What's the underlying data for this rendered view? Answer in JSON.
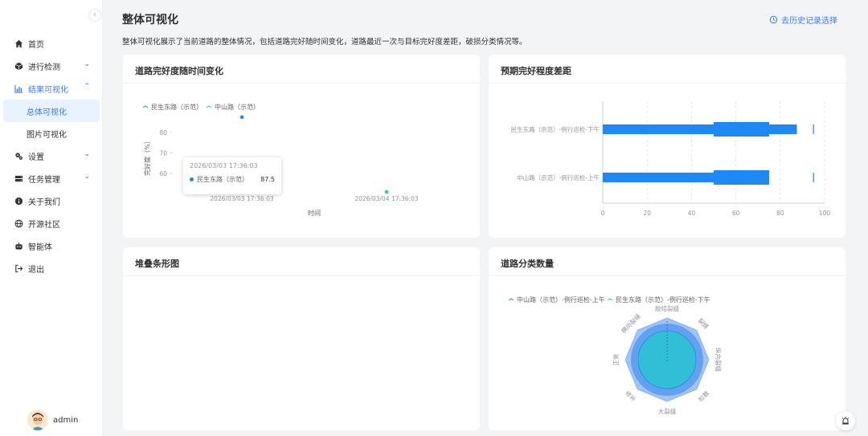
{
  "sidebar": {
    "collapse_glyph": "‹",
    "items": [
      {
        "label": "首页",
        "icon": "home-icon"
      },
      {
        "label": "进行检测",
        "icon": "cube-icon"
      },
      {
        "label": "结果可视化",
        "icon": "chart-icon"
      },
      {
        "label": "设置",
        "icon": "gear-icon"
      },
      {
        "label": "任务管理",
        "icon": "server-icon"
      },
      {
        "label": "关于我们",
        "icon": "info-icon"
      },
      {
        "label": "开源社区",
        "icon": "globe-icon"
      },
      {
        "label": "智能体",
        "icon": "robot-icon"
      },
      {
        "label": "退出",
        "icon": "logout-icon"
      }
    ],
    "submenu": [
      {
        "label": "总体可视化"
      },
      {
        "label": "图片可视化"
      }
    ],
    "user": {
      "name": "admin"
    }
  },
  "header": {
    "title": "整体可视化",
    "history_link": "去历史记录选择",
    "description": "整体可视化展示了当前道路的整体情况，包括道路完好随时间变化，道路最近一次与目标完好度差距，破损分类情况等。"
  },
  "colors": {
    "accent": "#3a7afe",
    "series_blue": "#1e88e5",
    "series_cyan": "#26c6da",
    "bar_blue": "#1e88f5"
  },
  "chart_data": [
    {
      "type": "scatter",
      "title": "道路完好度随时间变化",
      "xlabel": "时间",
      "ylabel": "完好度（%）",
      "y_ticks": [
        "60",
        "70",
        "80"
      ],
      "x_ticks": [
        "2026/03/03 17:36:03",
        "2026/03/04 17:36:03"
      ],
      "series": [
        {
          "name": "民生东路（示范）",
          "points": [
            {
              "x": "2026/03/03 17:36:03",
              "y": 87.5
            }
          ]
        },
        {
          "name": "中山路（示范）",
          "points": [
            {
              "x": "2026/03/04 17:36:03",
              "y": 51
            }
          ]
        }
      ],
      "tooltip": {
        "time": "2026/03/03 17:36:03",
        "series": "民生东路（示范）",
        "value": "87.5"
      }
    },
    {
      "type": "bar",
      "title": "预期完好程度差距",
      "categories": [
        "民生东路（示范）-例行巡检-下午",
        "中山路（示范）-例行巡检-上午"
      ],
      "x_ticks": [
        "0",
        "20",
        "40",
        "60",
        "80",
        "100"
      ],
      "xlim": [
        0,
        100
      ],
      "bars": [
        {
          "category": "民生东路（示范）-例行巡检-下午",
          "value": 87.5,
          "band_from": 50,
          "band_to": 75,
          "target": 95
        },
        {
          "category": "中山路（示范）-例行巡检-上午",
          "value": 75,
          "band_from": 50,
          "band_to": 75,
          "target": 95
        }
      ]
    },
    {
      "type": "bar",
      "title": "堆叠条形图",
      "series": []
    },
    {
      "type": "radar",
      "title": "道路分类数量",
      "indicators": [
        "胶结裂缝",
        "裂缝",
        "纵向裂缝",
        "松散",
        "大裂缝",
        "修补",
        "正常",
        "横向裂缝"
      ],
      "series": [
        {
          "name": "中山路（示范）-例行巡检-上午"
        },
        {
          "name": "民生东路（示范）-例行巡检-下午"
        }
      ]
    }
  ],
  "float_button": {
    "icon": "alarm-icon"
  }
}
